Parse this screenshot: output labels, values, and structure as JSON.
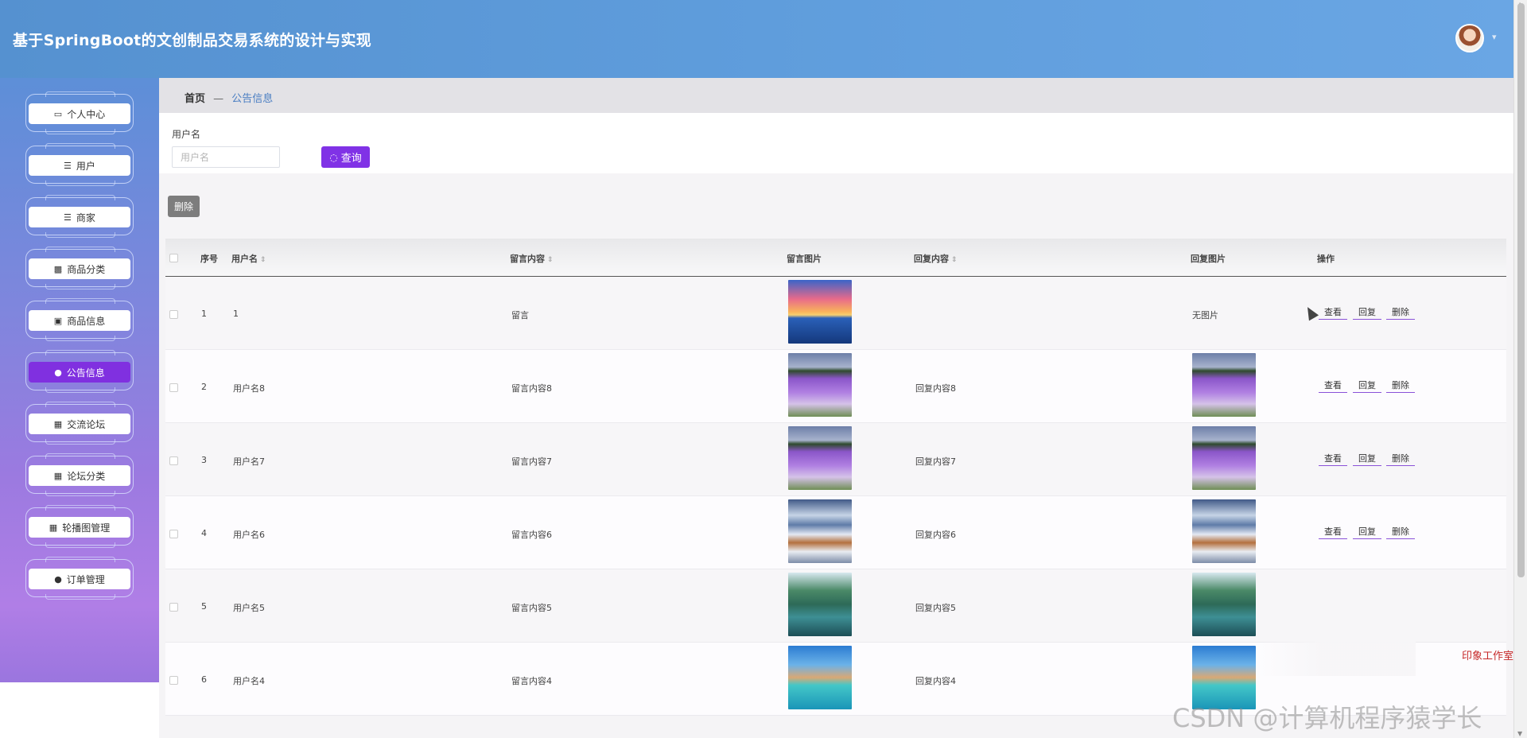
{
  "header": {
    "title": "基于SpringBoot的文创制品交易系统的设计与实现",
    "avatar_caret": "▾"
  },
  "sidebar": {
    "items": [
      {
        "label": "个人中心",
        "icon": "▭"
      },
      {
        "label": "用户",
        "icon": "☰"
      },
      {
        "label": "商家",
        "icon": "☰"
      },
      {
        "label": "商品分类",
        "icon": "▩"
      },
      {
        "label": "商品信息",
        "icon": "▣"
      },
      {
        "label": "公告信息",
        "icon": "●"
      },
      {
        "label": "交流论坛",
        "icon": "▦"
      },
      {
        "label": "论坛分类",
        "icon": "▦"
      },
      {
        "label": "轮播图管理",
        "icon": "▦"
      },
      {
        "label": "订单管理",
        "icon": "●"
      }
    ],
    "active_index": 5
  },
  "breadcrumb": {
    "home": "首页",
    "separator": "—",
    "current": "公告信息"
  },
  "search": {
    "label": "用户名",
    "placeholder": "用户名",
    "button_label": "查询",
    "button_icon": "◌"
  },
  "toolbar": {
    "delete_label": "删除"
  },
  "table": {
    "headers": {
      "index": "序号",
      "username": "用户名",
      "content": "留言内容",
      "image": "留言图片",
      "reply": "回复内容",
      "reply_image": "回复图片",
      "actions": "操作"
    },
    "sort_icon": "⇕",
    "rows": [
      {
        "index": "1",
        "username": "1",
        "content": "留言",
        "image": "dolphin",
        "reply": "",
        "reply_image": "",
        "reply_image_text": "无图片"
      },
      {
        "index": "2",
        "username": "用户名8",
        "content": "留言内容8",
        "image": "lavender",
        "reply": "回复内容8",
        "reply_image": "lavender",
        "reply_image_text": ""
      },
      {
        "index": "3",
        "username": "用户名7",
        "content": "留言内容7",
        "image": "lavender",
        "reply": "回复内容7",
        "reply_image": "lavender",
        "reply_image_text": ""
      },
      {
        "index": "4",
        "username": "用户名6",
        "content": "留言内容6",
        "image": "snow",
        "reply": "回复内容6",
        "reply_image": "snow",
        "reply_image_text": ""
      },
      {
        "index": "5",
        "username": "用户名5",
        "content": "留言内容5",
        "image": "karst",
        "reply": "回复内容5",
        "reply_image": "karst",
        "reply_image_text": ""
      },
      {
        "index": "6",
        "username": "用户名4",
        "content": "留言内容4",
        "image": "beach",
        "reply": "回复内容4",
        "reply_image": "beach",
        "reply_image_text": ""
      }
    ],
    "actions": {
      "view": "查看",
      "reply": "回复",
      "delete": "删除"
    }
  },
  "watermarks": {
    "studio": "印象工作室",
    "csdn": "CSDN @计算机程序猿学长"
  },
  "colors": {
    "header_bg": "#5f9ddc",
    "active_nav": "#8030e0",
    "search_button": "#8032e6",
    "delete_button": "#7d7d7d",
    "breadcrumb_current": "#4a7ec2"
  }
}
